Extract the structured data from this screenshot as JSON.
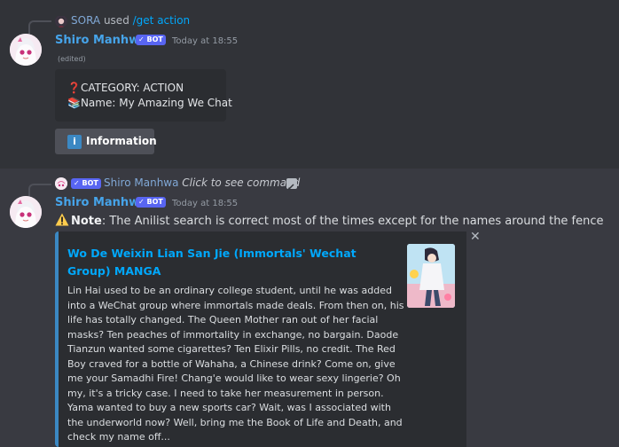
{
  "message1": {
    "context": {
      "user": "SORA",
      "used": "used",
      "command": "/get action"
    },
    "author": {
      "name": "Shiro Manhwa",
      "bot_tag": "✓ BOT",
      "timestamp": "Today at 18:55"
    },
    "edited": "(edited)",
    "box_lines": [
      {
        "icon": "❓",
        "text": "CATEGORY: ACTION"
      },
      {
        "icon": "📚",
        "text": "Name: My Amazing We Chat"
      }
    ],
    "button": {
      "icon": "i",
      "label": "Information"
    }
  },
  "message2": {
    "context": {
      "bot_tag": "✓ BOT",
      "user": "Shiro Manhwa",
      "text": "Click to see command"
    },
    "author": {
      "name": "Shiro Manhwa",
      "bot_tag": "✓ BOT",
      "timestamp": "Today at 18:55"
    },
    "note": {
      "bold": "Note",
      "text": ": The Anilist search is correct most of the times except for the names around the fence"
    },
    "embed": {
      "title": "Wo De Weixin Lian San Jie (Immortals' Wechat Group) MANGA",
      "description": "Lin Hai used to be an ordinary college student, until he was added into a WeChat group where immortals made deals. From then on, his life has totally changed. The Queen Mother ran out of her facial masks? Ten peaches of immortality in exchange, no bargain. Daode Tianzun wanted some cigarettes? Ten Elixir Pills, no credit. The Red Boy craved for a bottle of Wahaha, a Chinese drink? Come on, give me your Samadhi Fire! Chang'e would like to wear sexy lingerie? Oh my, it's a tricky case. I need to take her measurement in person. Yama wanted to buy a new sports car? Wait, was I associated with the underworld now? Well, bring me the Book of Life and Death, and check my name off...",
      "accent_color": "#3b88c3"
    }
  }
}
